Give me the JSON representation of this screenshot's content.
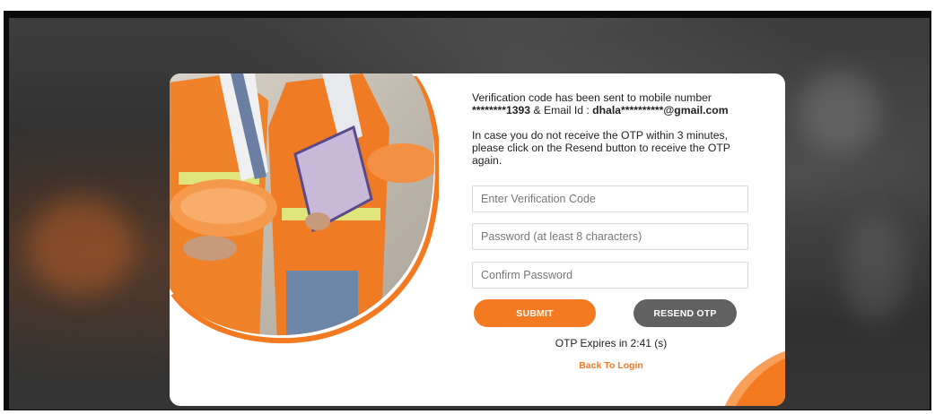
{
  "verification": {
    "sent_line1": "Verification code has been sent to mobile number",
    "masked_mobile": "********1393",
    "email_prefix": " & Email Id : ",
    "masked_email": "dhala**********@gmail.com",
    "resend_note_line1": "In case you do not receive the OTP within 3 minutes,",
    "resend_note_line2": "please click on the Resend button to receive the OTP",
    "resend_note_line3": "again."
  },
  "form": {
    "code_placeholder": "Enter Verification Code",
    "password_placeholder": "Password (at least 8 characters)",
    "confirm_placeholder": "Confirm Password",
    "submit_label": "SUBMIT",
    "resend_label": "RESEND OTP"
  },
  "expiry_text": "OTP Expires in 2:41 (s)",
  "back_link": "Back To Login",
  "colors": {
    "accent": "#f47a22",
    "secondary_button": "#616161"
  },
  "illustration": "construction-workers-photo"
}
